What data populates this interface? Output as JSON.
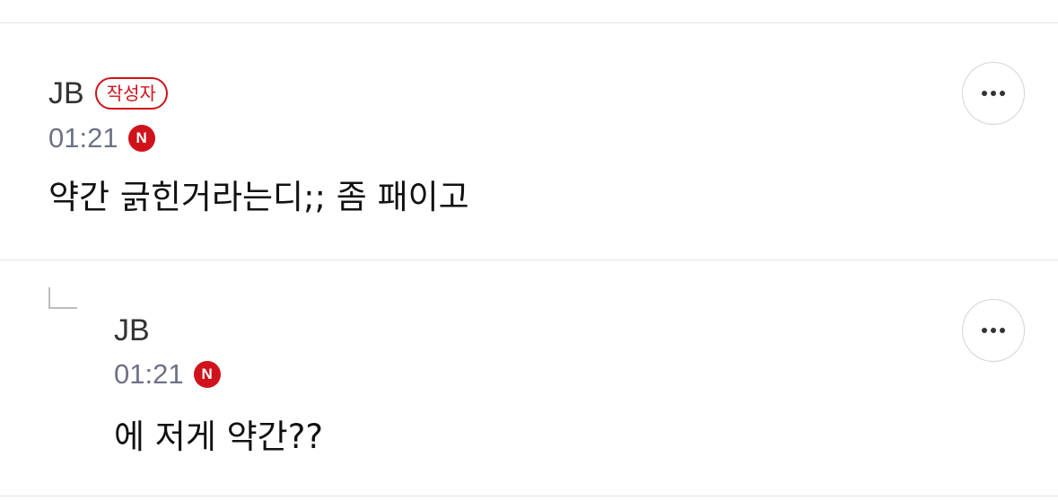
{
  "comments": [
    {
      "author": "JB",
      "author_badge": "작성자",
      "time": "01:21",
      "n_badge": "N",
      "text": "약간 긁힌거라는디;; 좀 패이고"
    },
    {
      "author": "JB",
      "time": "01:21",
      "n_badge": "N",
      "text": "에 저게 약간??"
    }
  ],
  "icons": {
    "more": "more-horizontal-icon",
    "reply": "reply-indent-icon",
    "new": "new-badge"
  },
  "colors": {
    "accent": "#d0121b",
    "meta": "#6e7287",
    "divider": "#e4e4e4"
  }
}
